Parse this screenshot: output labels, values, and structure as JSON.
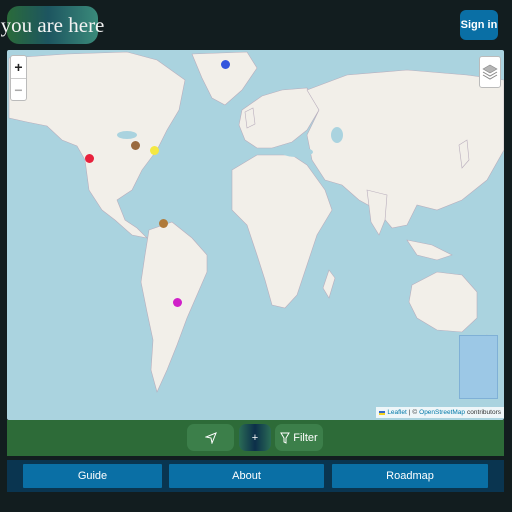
{
  "header": {
    "logo_text": "you are here",
    "signin_label": "Sign in"
  },
  "map": {
    "zoom_in_label": "+",
    "zoom_out_label": "−",
    "attribution": {
      "leaflet": "Leaflet",
      "separator": "| ©",
      "osm": "OpenStreetMap",
      "suffix": "contributors"
    },
    "colors": {
      "water": "#aad3df",
      "land": "#f2efe9",
      "border": "#9d8fa4"
    },
    "markers": [
      {
        "name": "marker-greenland",
        "color": "#3355dd"
      },
      {
        "name": "marker-california",
        "color": "#e8213c"
      },
      {
        "name": "marker-great-lakes",
        "color": "#9a6a3e"
      },
      {
        "name": "marker-east-coast",
        "color": "#f4e842"
      },
      {
        "name": "marker-venezuela",
        "color": "#b07a3a"
      },
      {
        "name": "marker-paraguay",
        "color": "#d020c8"
      }
    ]
  },
  "toolbar": {
    "locate_icon": "navigation-arrow-icon",
    "add_label": "+",
    "filter_label": "Filter",
    "filter_icon": "funnel-icon"
  },
  "nav": {
    "guide": "Guide",
    "about": "About",
    "roadmap": "Roadmap"
  },
  "colors": {
    "background": "#121d1f",
    "signin": "#0a6fa5",
    "toolbar": "#2d6b38",
    "navbar": "#0a3550"
  }
}
